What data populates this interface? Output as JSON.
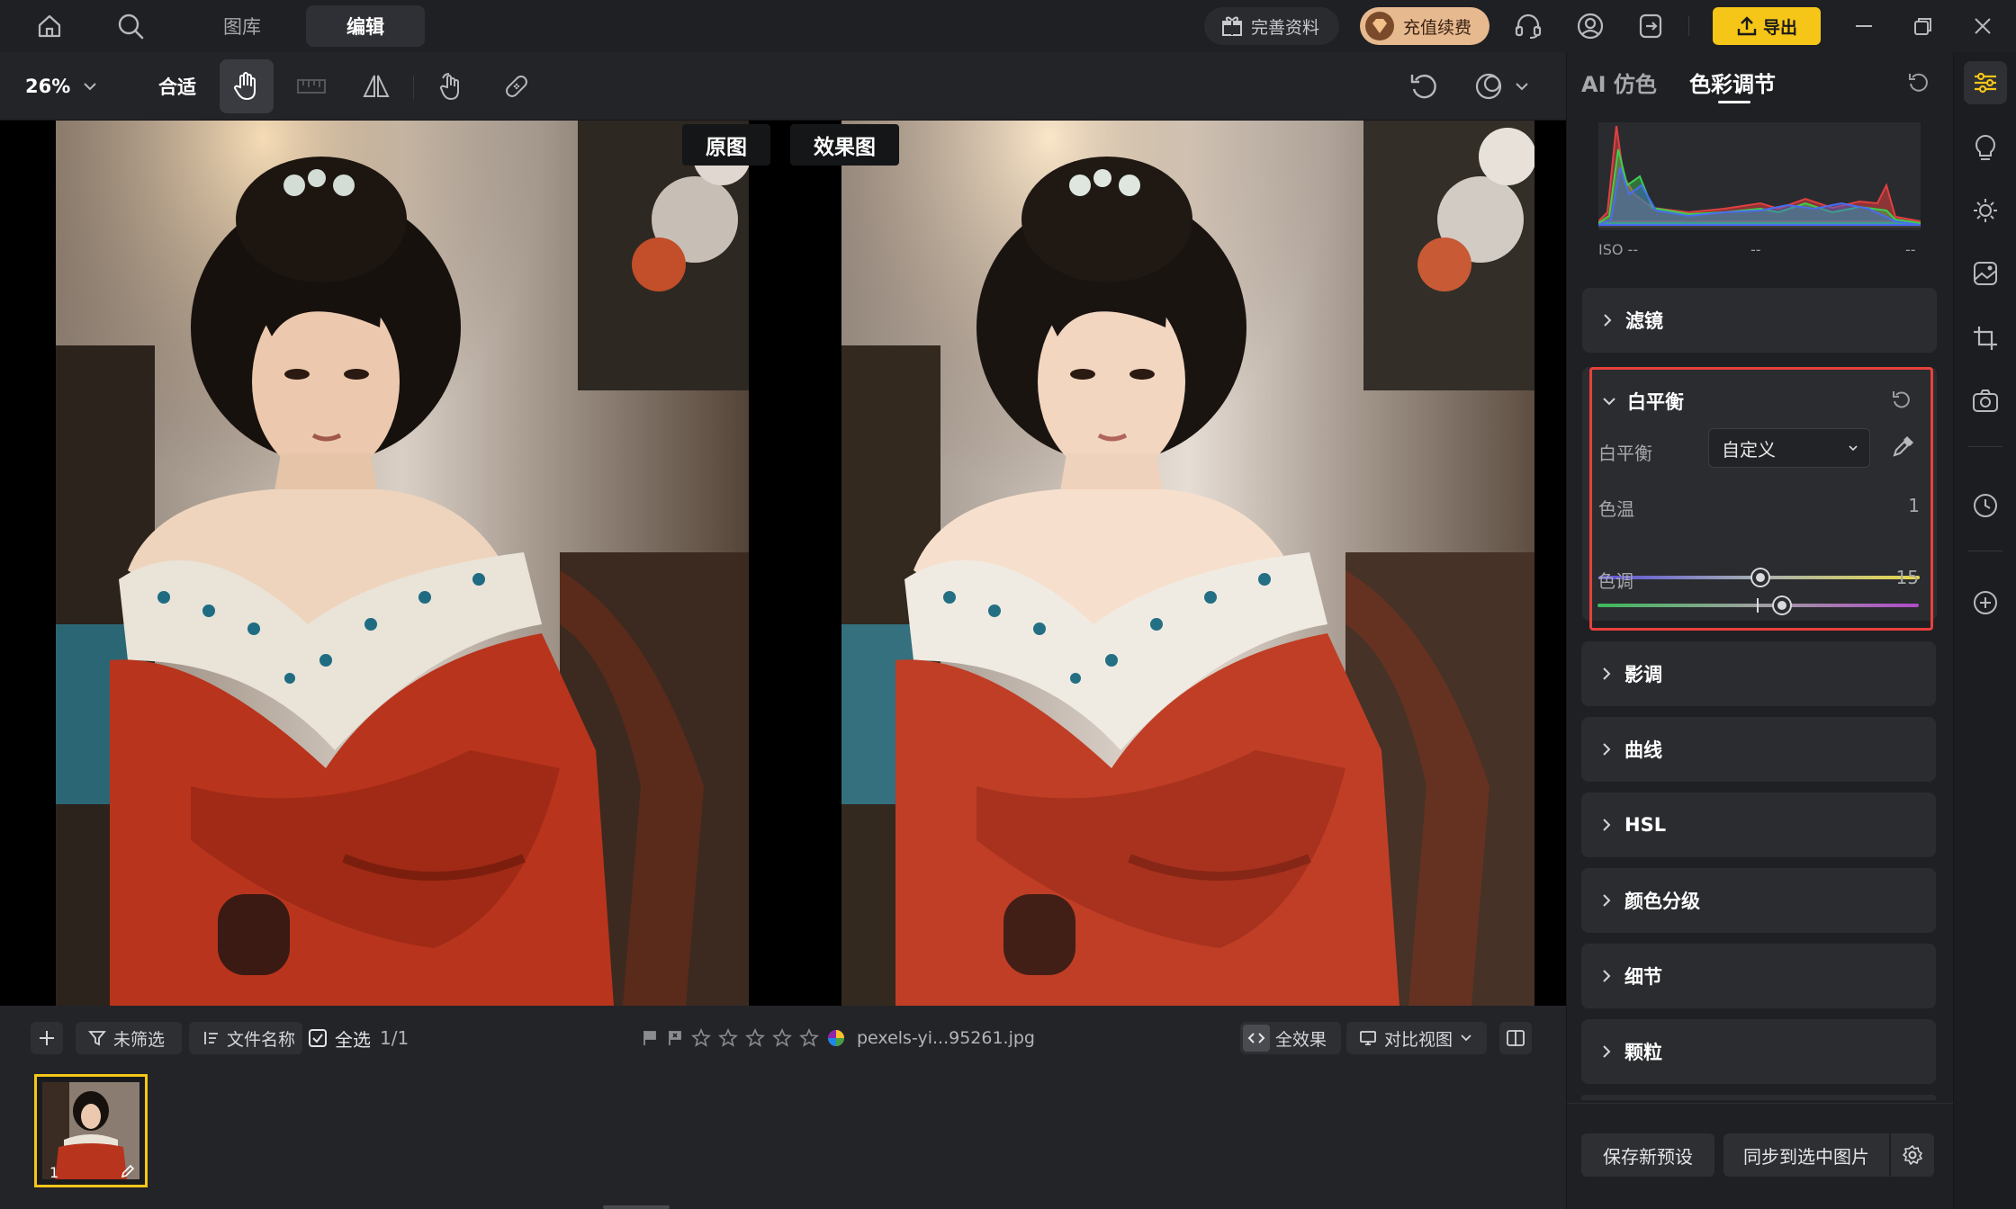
{
  "topbar": {
    "tabs": [
      "图库",
      "编辑"
    ],
    "complete_info": "完善资料",
    "recharge": "充值续费",
    "export": "导出"
  },
  "toolbar": {
    "zoom": "26%",
    "fit": "合适"
  },
  "canvas": {
    "before_label": "原图",
    "after_label": "效果图"
  },
  "strip": {
    "filter": "未筛选",
    "sort": "文件名称",
    "select_all": "全选",
    "count": "1/1",
    "filename": "pexels-yi...95261.jpg",
    "all_effects": "全效果",
    "compare_view": "对比视图",
    "thumb_index": "1"
  },
  "panel": {
    "tabs": [
      "AI 仿色",
      "色彩调节"
    ],
    "histogram": {
      "iso": "ISO --",
      "mid": "--",
      "right": "--"
    },
    "sections": [
      "滤镜",
      "影调",
      "曲线",
      "HSL",
      "颜色分级",
      "细节",
      "颗粒"
    ],
    "white_balance": {
      "title": "白平衡",
      "wb_label": "白平衡",
      "wb_value": "自定义",
      "temp_label": "色温",
      "temp_value": "1",
      "tint_label": "色调",
      "tint_value": "15",
      "temp_fraction": 0.505,
      "tint_fraction": 0.575
    },
    "save_preset": "保存新预设",
    "sync": "同步到选中图片"
  },
  "colors": {
    "accent_yellow": "#f5c518",
    "highlight_red": "#e8403c",
    "dress_red": "#b8341c"
  }
}
